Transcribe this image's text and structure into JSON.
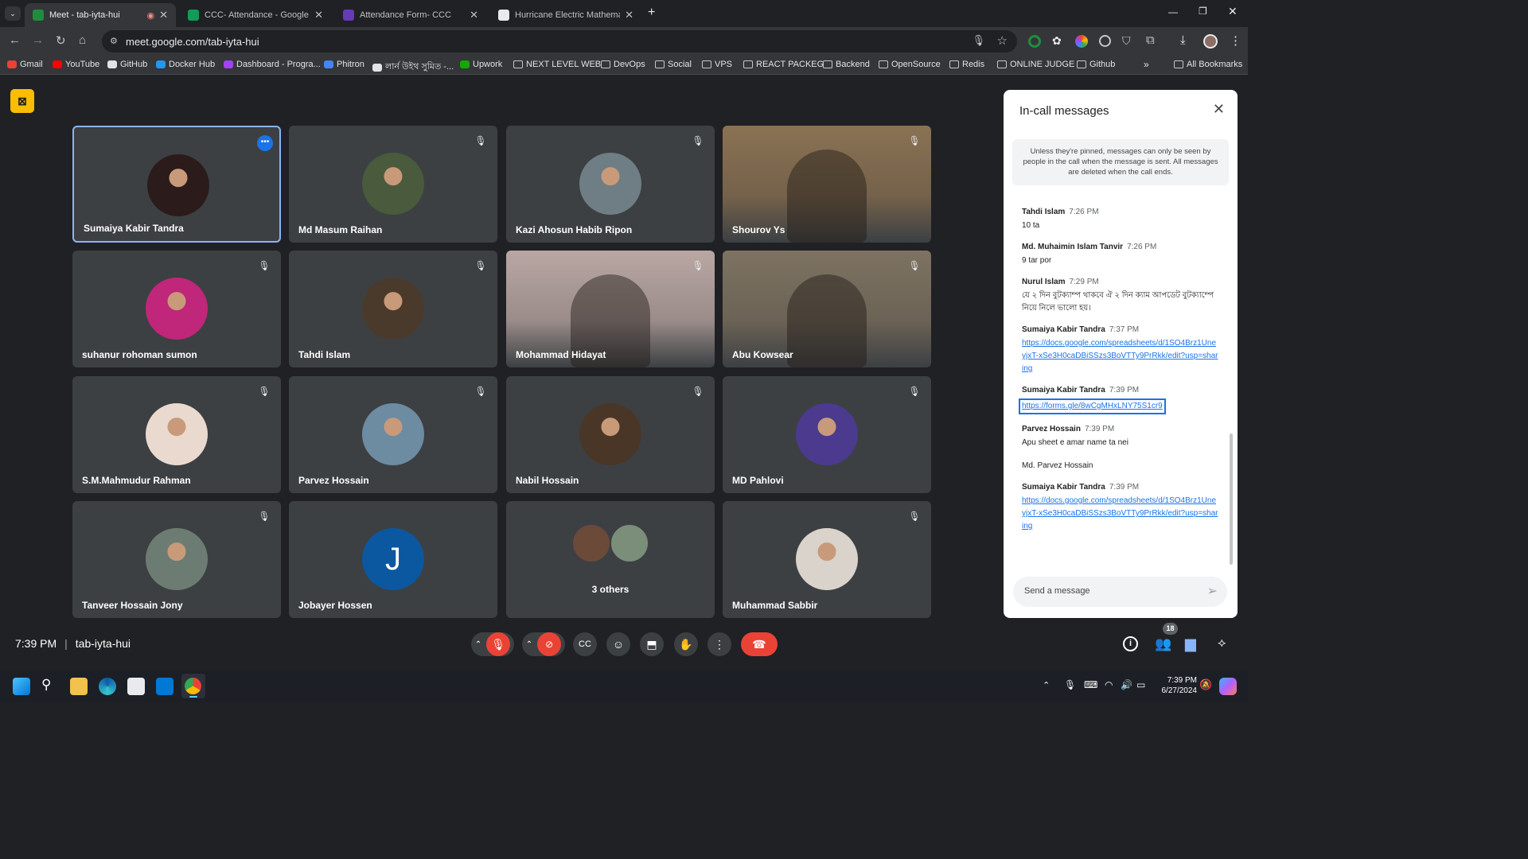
{
  "tabs": [
    {
      "title": "Meet - tab-iyta-hui",
      "active": true,
      "color": "#1e8e3e"
    },
    {
      "title": "CCC- Attendance - Google Shee",
      "active": false,
      "color": "#0f9d58"
    },
    {
      "title": "Attendance Form- CCC",
      "active": false,
      "color": "#673ab7"
    },
    {
      "title": "Hurricane Electric Mathematics",
      "active": false,
      "color": "#e8eaed"
    }
  ],
  "url": "meet.google.com/tab-iyta-hui",
  "bookmarks": [
    "Gmail",
    "YouTube",
    "GitHub",
    "Docker Hub",
    "Dashboard - Progra...",
    "Phitron",
    "লার্ন উইথ সুমিত -...",
    "Upwork",
    "NEXT LEVEL WEB",
    "DevOps",
    "Social",
    "VPS",
    "REACT PACKEG",
    "Backend",
    "OpenSource",
    "Redis",
    "ONLINE JUDGE",
    "Github"
  ],
  "all_bookmarks": "All Bookmarks",
  "participants": [
    {
      "name": "Sumaiya Kabir Tandra",
      "kind": "avatar",
      "color": "#2b1b1b"
    },
    {
      "name": "Md Masum Raihan",
      "kind": "avatar",
      "color": "#4a5a3c"
    },
    {
      "name": "Kazi Ahosun Habib Ripon",
      "kind": "avatar",
      "color": "#6f7d84"
    },
    {
      "name": "Shourov Ys",
      "kind": "video",
      "color": "#8a7254"
    },
    {
      "name": "suhanur rohoman sumon",
      "kind": "avatar",
      "color": "#c0267a"
    },
    {
      "name": "Tahdi Islam",
      "kind": "avatar",
      "color": "#4a3a2c"
    },
    {
      "name": "Mohammad Hidayat",
      "kind": "video",
      "color": "#b9a7a3"
    },
    {
      "name": "Abu Kowsear",
      "kind": "video",
      "color": "#7e7362"
    },
    {
      "name": "S.M.Mahmudur Rahman",
      "kind": "avatar",
      "color": "#e9d9cf"
    },
    {
      "name": "Parvez Hossain",
      "kind": "avatar",
      "color": "#6d8ba1"
    },
    {
      "name": "Nabil Hossain",
      "kind": "avatar",
      "color": "#4a3627"
    },
    {
      "name": "MD Pahlovi",
      "kind": "avatar",
      "color": "#4b3a8e"
    },
    {
      "name": "Tanveer Hossain Jony",
      "kind": "avatar",
      "color": "#6d7c72"
    },
    {
      "name": "Jobayer Hossen",
      "kind": "letter",
      "letter": "J",
      "color": "#0b57a0"
    },
    {
      "name": "3 others",
      "kind": "others",
      "color": "#5f6368"
    },
    {
      "name": "Muhammad Sabbir",
      "kind": "avatar",
      "color": "#d9d3cc"
    }
  ],
  "panel": {
    "title": "In-call messages",
    "notice": "Unless they're pinned, messages can only be seen by people in the call when the message is sent. All messages are deleted when the call ends.",
    "messages": [
      {
        "sender": "Tahdi Islam",
        "time": "7:26 PM",
        "text": "10 ta",
        "link": false
      },
      {
        "sender": "Md. Muhaimin Islam Tanvir",
        "time": "7:26 PM",
        "text": "9 tar por",
        "link": false
      },
      {
        "sender": "Nurul Islam",
        "time": "7:29 PM",
        "text": "যে ২ দিন বুটক্যাম্প থাকবে ঐ ২ দিন ক্যাম আপডেট বুটক্যাম্পে নিয়ে নিলে ভালো হয়।",
        "link": false
      },
      {
        "sender": "Sumaiya Kabir Tandra",
        "time": "7:37 PM",
        "text": "https://docs.google.com/spreadsheets/d/1SO4Brz1UneyjxT-xSe3H0caDBiSSzs3BoVTTy9PrRkk/edit?usp=sharing",
        "link": true
      },
      {
        "sender": "Sumaiya Kabir Tandra",
        "time": "7:39 PM",
        "text": "https://forms.gle/8wCgMHxLNY75S1cr9",
        "link": true,
        "highlight": true
      },
      {
        "sender": "Parvez Hossain",
        "time": "7:39 PM",
        "text": "Apu sheet e amar name ta nei",
        "link": false
      },
      {
        "sender": "",
        "time": "",
        "text": "Md. Parvez Hossain",
        "link": false
      },
      {
        "sender": "Sumaiya Kabir Tandra",
        "time": "7:39 PM",
        "text": "https://docs.google.com/spreadsheets/d/1SO4Brz1UneyjxT-xSe3H0caDBiSSzs3BoVTTy9PrRkk/edit?usp=sharing",
        "link": true
      }
    ],
    "input_placeholder": "Send a message"
  },
  "bottom": {
    "time": "7:39 PM",
    "code": "tab-iyta-hui",
    "participant_count": "18"
  },
  "clock": {
    "time": "7:39 PM",
    "date": "6/27/2024"
  }
}
